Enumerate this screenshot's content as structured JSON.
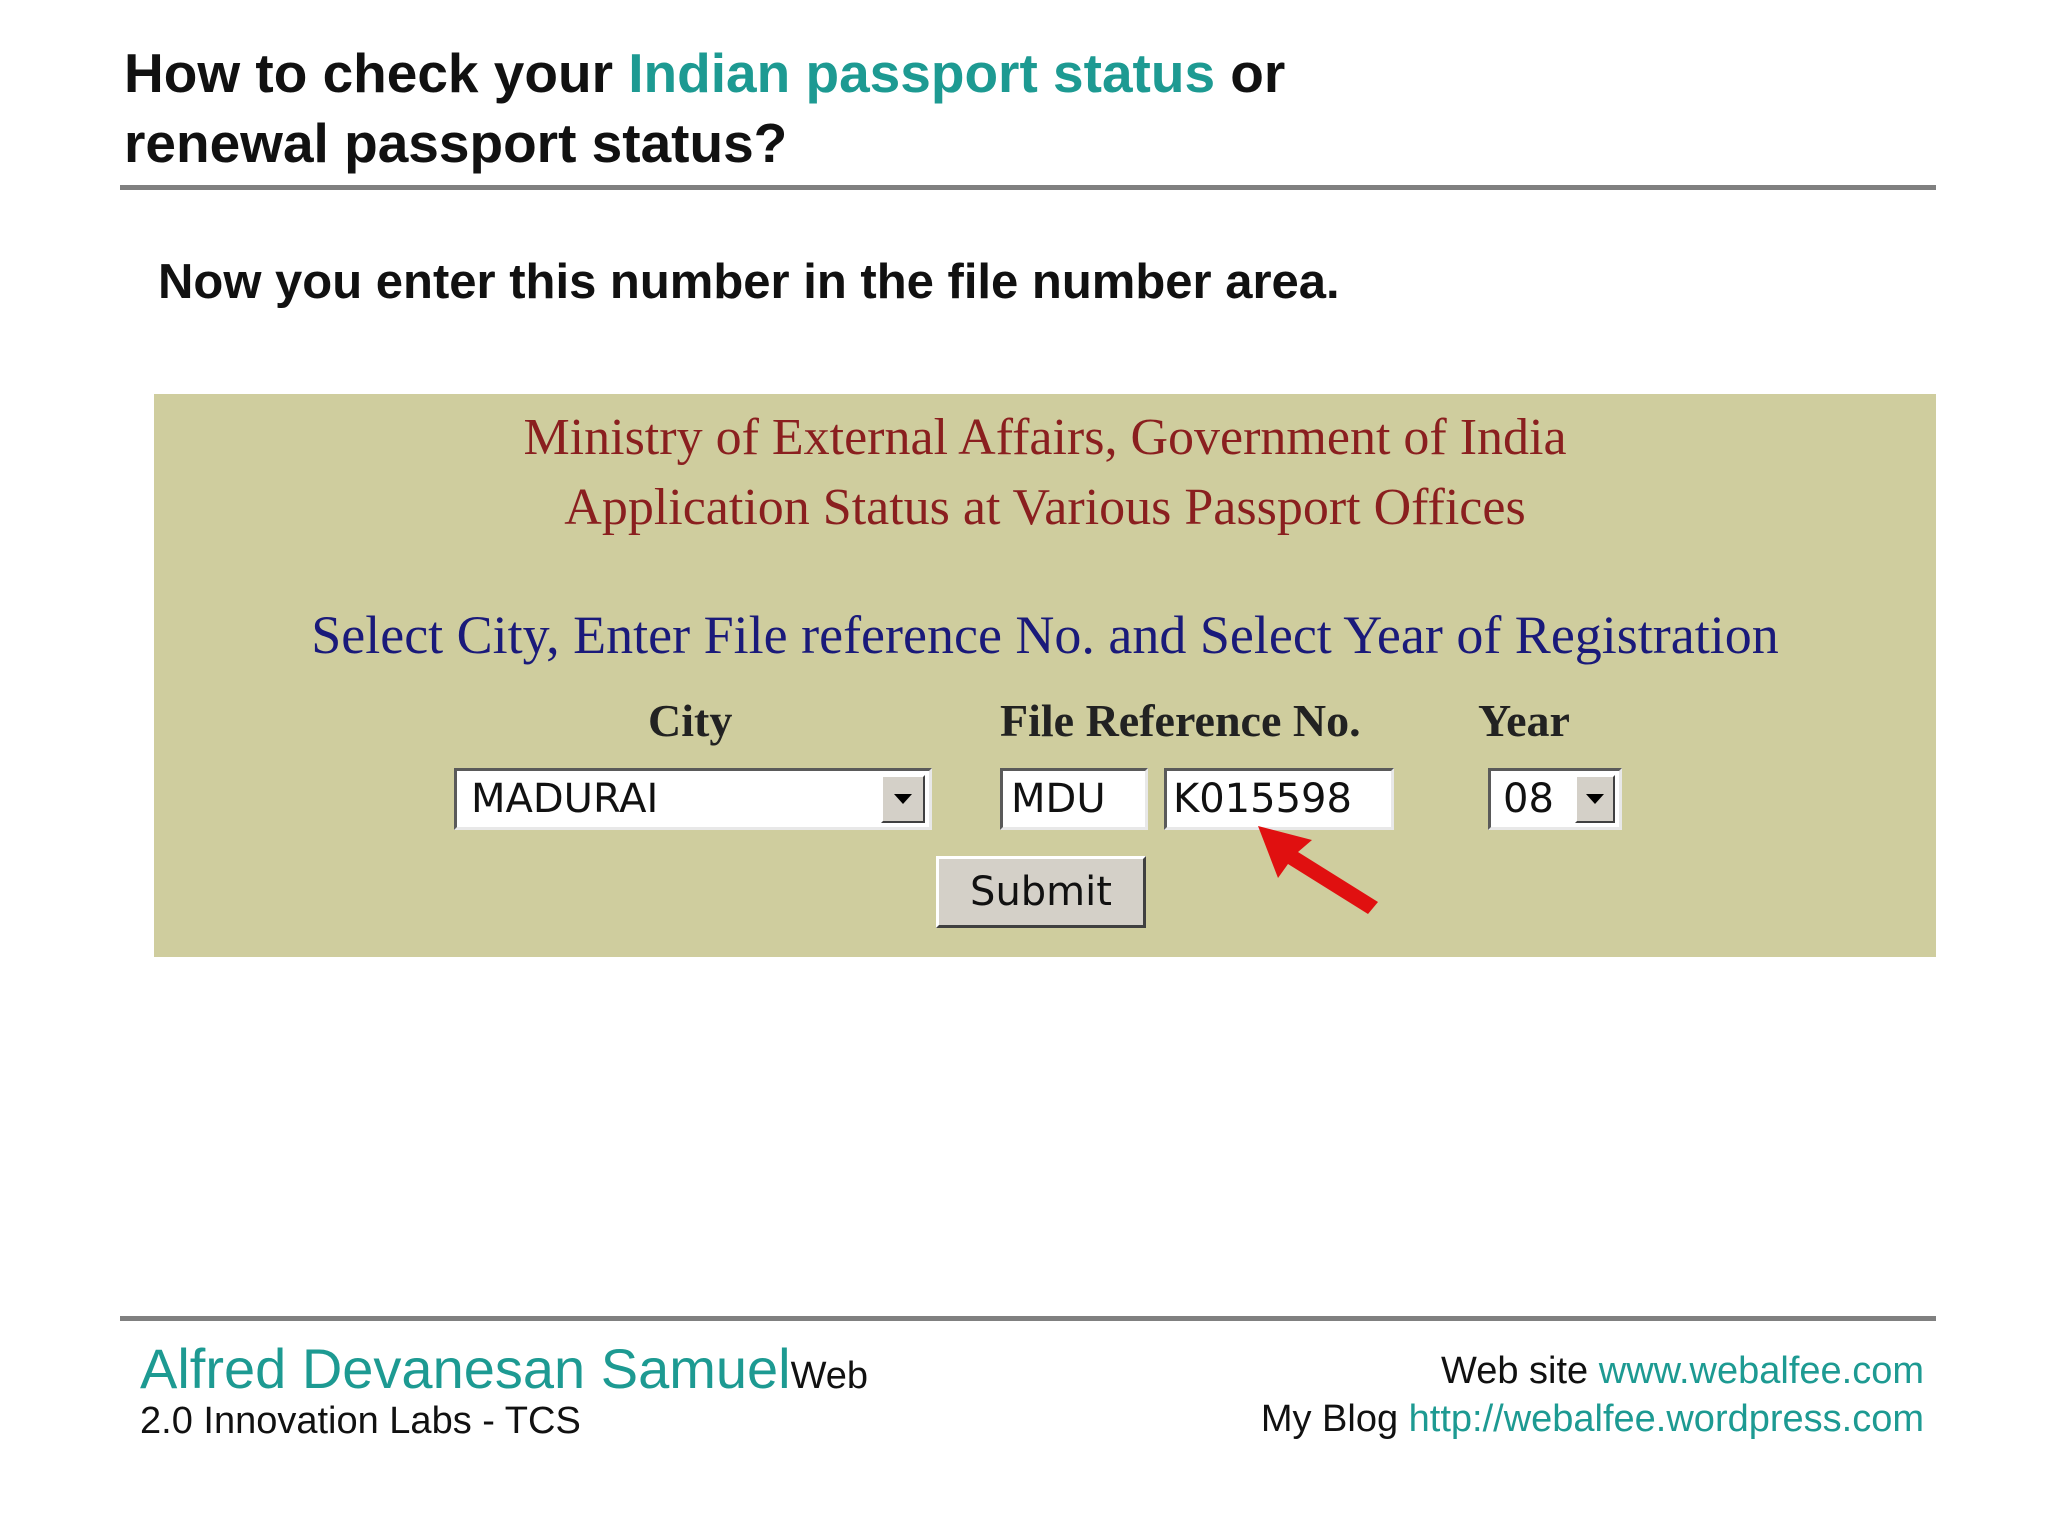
{
  "header": {
    "title_part1": "How to check your ",
    "title_accent": "Indian passport status",
    "title_part2": " or",
    "title_line2": "renewal passport status?",
    "accent_color": "#1d9a92"
  },
  "instruction": "Now you enter this number in the file number area.",
  "form": {
    "background_color": "#cfcd9e",
    "heading_line1": "Ministry of External Affairs, Government of India",
    "heading_line2": "Application Status at Various Passport Offices",
    "prompt": "Select City, Enter File reference No. and Select Year of Registration",
    "labels": {
      "city": "City",
      "file_reference": "File Reference No.",
      "year": "Year"
    },
    "city_selected": "MADURAI",
    "file_prefix_value": "MDU",
    "file_number_value": "K015598",
    "year_selected": "08",
    "submit_label": "Submit",
    "dropdown_icon": "chevron-down-icon",
    "arrow_icon": "red-pointer-arrow-icon",
    "arrow_color": "#e01010"
  },
  "footer": {
    "author_name": "Alfred Devanesan Samuel",
    "org_part1": "Web",
    "org_part2": "2.0 Innovation Labs - TCS",
    "website_label": "Web site ",
    "website_url": "www.webalfee.com",
    "blog_label": "My Blog ",
    "blog_url": "http://webalfee.wordpress.com"
  }
}
